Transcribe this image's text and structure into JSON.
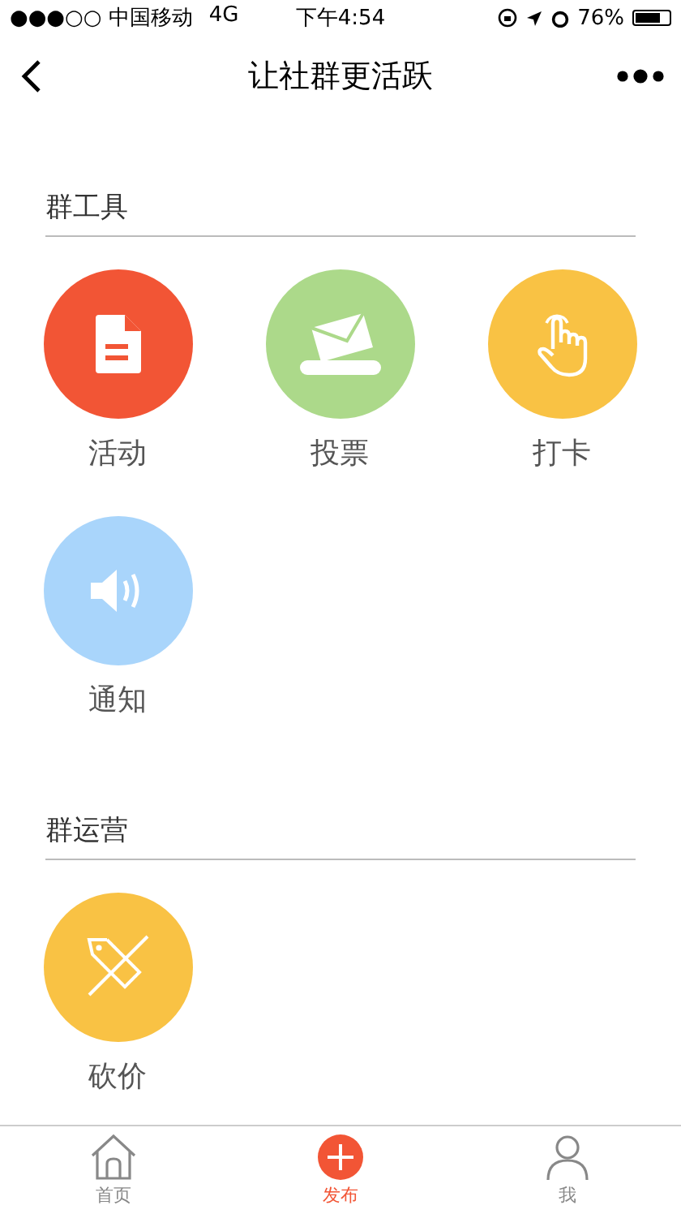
{
  "status_bar": {
    "carrier": "●●●○○ 中国移动",
    "network": "4G",
    "time": "下午4:54",
    "battery": "76%"
  },
  "nav": {
    "title": "让社群更活跃"
  },
  "sections": [
    {
      "title": "群工具",
      "items": [
        {
          "label": "活动",
          "color": "#f25535",
          "kind": "document"
        },
        {
          "label": "投票",
          "color": "#acd98a",
          "kind": "envelope"
        },
        {
          "label": "打卡",
          "color": "#f9c244",
          "kind": "hand"
        },
        {
          "label": "通知",
          "color": "#a9d5fb",
          "kind": "speaker"
        }
      ]
    },
    {
      "title": "群运营",
      "items": [
        {
          "label": "砍价",
          "color": "#f9c244",
          "kind": "tag"
        }
      ]
    }
  ],
  "tabs": [
    {
      "label": "首页",
      "kind": "home",
      "selected": false
    },
    {
      "label": "发布",
      "kind": "plus",
      "selected": true
    },
    {
      "label": "我",
      "kind": "person",
      "selected": false
    }
  ]
}
